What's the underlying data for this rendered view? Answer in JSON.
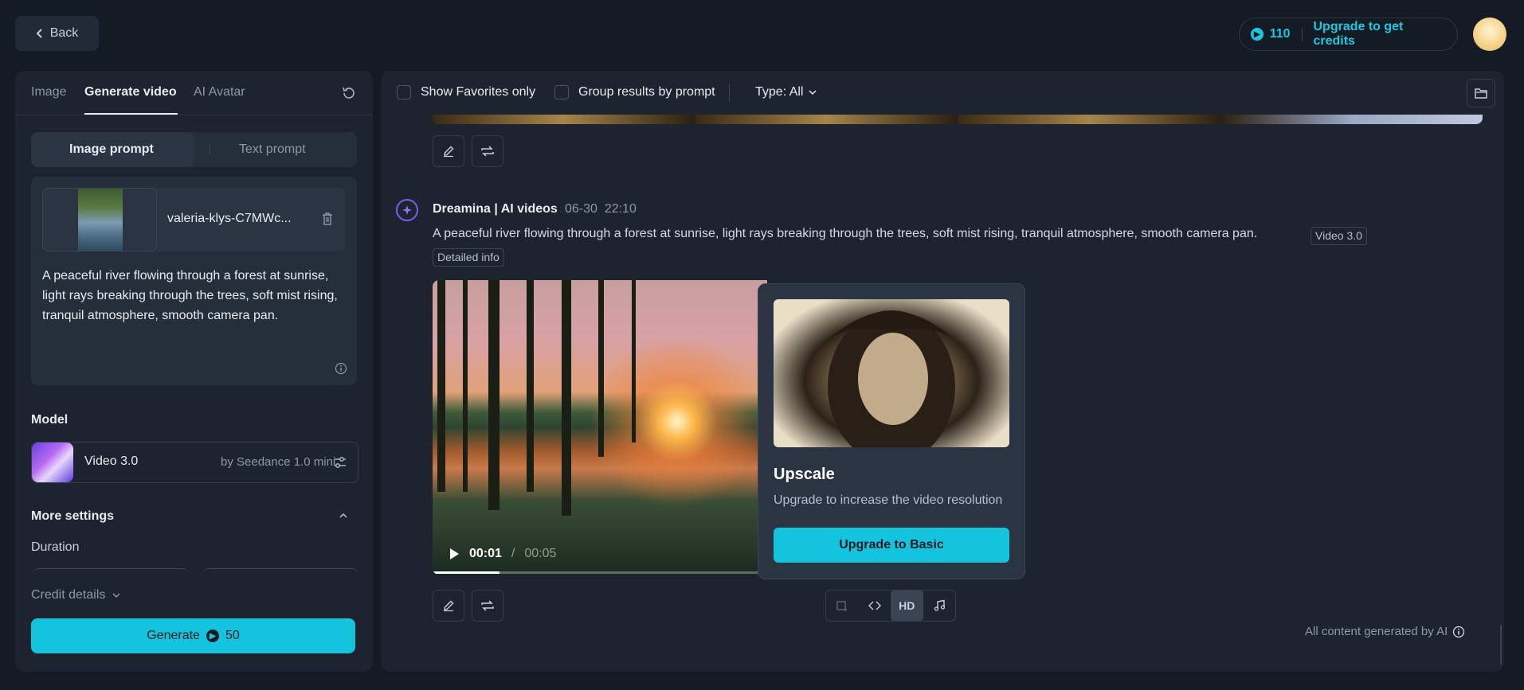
{
  "topbar": {
    "back_label": "Back",
    "credits": "110",
    "upgrade_label": "Upgrade to get credits"
  },
  "left_panel": {
    "tabs": [
      "Image",
      "Generate video",
      "AI Avatar"
    ],
    "prompt_modes": [
      "Image prompt",
      "Text prompt"
    ],
    "image_name": "valeria-klys-C7MWc...",
    "prompt_text": "A peaceful river flowing through a forest at sunrise, light rays breaking through the trees, soft mist rising, tranquil atmosphere, smooth camera pan.",
    "model_label": "Model",
    "model_name": "Video 3.0",
    "model_by": "by Seedance 1.0 mini",
    "more_settings": "More settings",
    "duration_label": "Duration",
    "credit_details": "Credit details",
    "generate_label": "Generate",
    "generate_cost": "50"
  },
  "filters": {
    "favorites": "Show Favorites only",
    "group": "Group results by prompt",
    "type": "Type: All"
  },
  "message": {
    "author": "Dreamina | AI videos",
    "date": "06-30",
    "time": "22:10",
    "prompt": "A peaceful river flowing through a forest at sunrise, light rays breaking through the trees, soft mist rising, tranquil atmosphere, smooth camera pan.",
    "version_chip": "Video 3.0",
    "detailed_info": "Detailed info"
  },
  "video": {
    "current_time": "00:01",
    "separator": "/",
    "total_time": "00:05",
    "progress": 0.2
  },
  "upscale_popup": {
    "title": "Upscale",
    "description": "Upgrade to increase the video resolution",
    "button": "Upgrade to Basic"
  },
  "tools": {
    "hd_label": "HD"
  },
  "footer": {
    "disclaimer": "All content generated by AI"
  },
  "colors": {
    "accent": "#14c4de",
    "background": "#151b24",
    "panel": "#1d2430"
  }
}
